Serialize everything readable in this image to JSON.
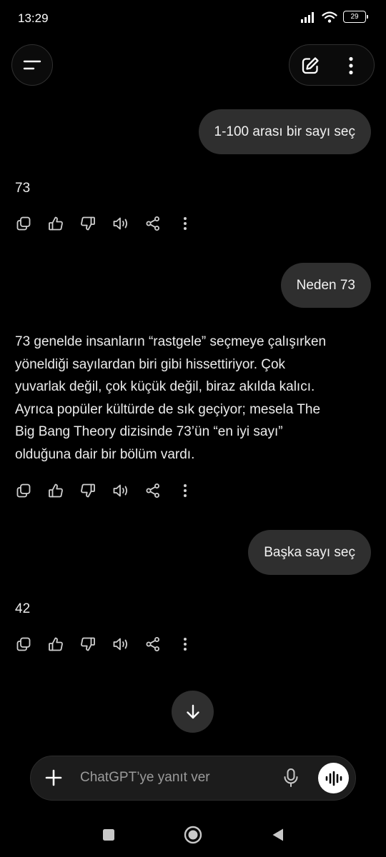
{
  "status_bar": {
    "time": "13:29",
    "battery_level": "29",
    "icons": [
      "signal-icon",
      "wifi-icon",
      "battery-icon"
    ]
  },
  "header": {
    "icons": [
      "menu-icon",
      "new-chat-icon",
      "more-vertical-icon"
    ]
  },
  "messages": {
    "m1_user": "1-100 arası bir sayı seç",
    "m2_assistant": "73",
    "m3_user": "Neden 73",
    "m4_assistant": {
      "lines": [
        "73 genelde insanların “rastgele” seçmeye çalışırken",
        "yöneldiği sayılardan biri gibi hissettiriyor. Çok",
        "yuvarlak değil, çok küçük değil, biraz akılda kalıcı.",
        "Ayrıca popüler kültürde de sık geçiyor; mesela The",
        "Big Bang Theory dizisinde 73’ün “en iyi sayı”",
        "olduğuna dair bir bölüm vardı."
      ]
    },
    "m5_user": "Başka sayı seç",
    "m6_assistant": "42"
  },
  "message_actions": [
    "copy-icon",
    "thumbs-up-icon",
    "thumbs-down-icon",
    "read-aloud-icon",
    "share-icon",
    "more-vertical-icon"
  ],
  "composer": {
    "placeholder": "ChatGPT’ye yanıt ver",
    "icons": [
      "plus-icon",
      "microphone-icon",
      "voice-mode-icon"
    ]
  },
  "navigation": {
    "icons": [
      "recents-icon",
      "home-icon",
      "back-icon"
    ]
  },
  "colors": {
    "background": "#000000",
    "user_bubble": "#2f2f2f",
    "text": "#ececec",
    "muted_text": "#9b9b9b",
    "composer": "#1c1c1c"
  }
}
